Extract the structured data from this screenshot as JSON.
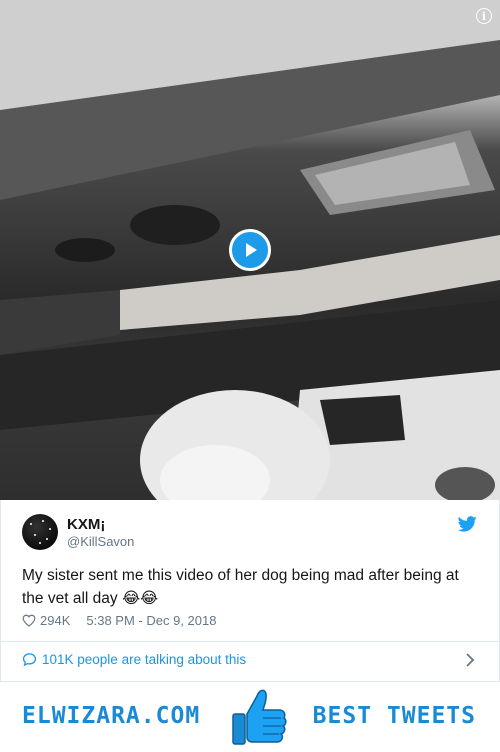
{
  "video": {
    "info_icon": "info-icon",
    "play_icon": "play-icon"
  },
  "tweet": {
    "display_name": "KXM¡",
    "handle": "@KillSavon",
    "text": "My sister sent me this video of her dog being mad after being at the vet all day 😂😂",
    "likes": "294K",
    "timestamp": "5:38 PM - Dec 9, 2018",
    "conversation": "101K people are talking about this"
  },
  "banner": {
    "site": "ELWIZARA.COM",
    "tagline": "BEST TWEETS",
    "icon": "thumbs-up-icon"
  },
  "colors": {
    "brand_blue": "#1da1f2",
    "link_blue": "#1b95e0",
    "banner_blue": "#1a8ad4",
    "muted_text": "#657786"
  }
}
